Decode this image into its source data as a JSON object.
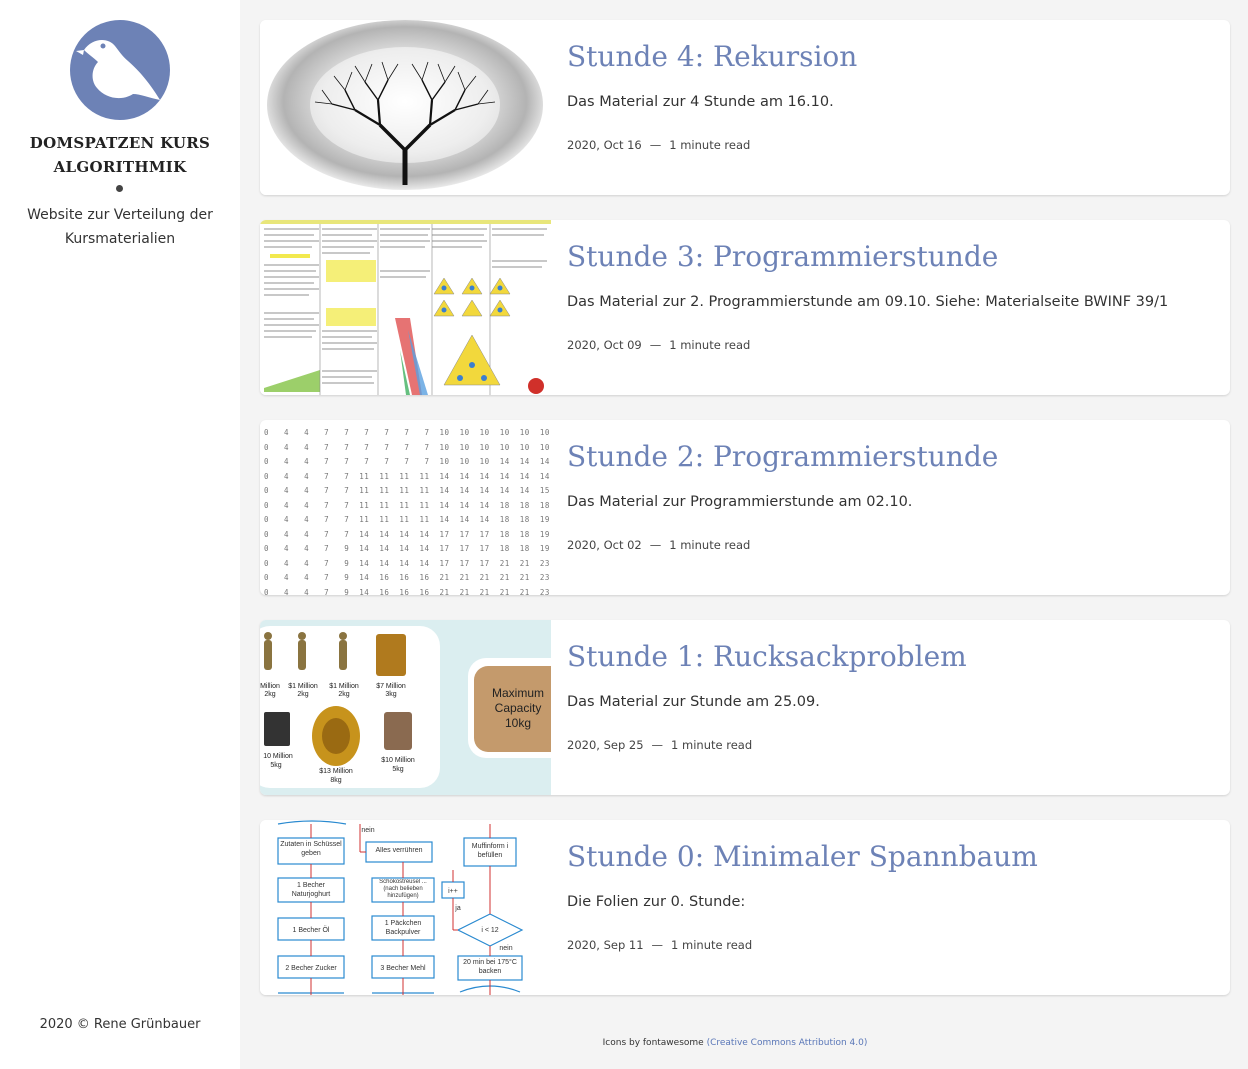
{
  "sidebar": {
    "logo_icon": "bird-icon",
    "title_line1": "DOMSPATZEN KURS",
    "title_line2": "ALGORITHMIK",
    "description": "Website zur Verteilung der Kursmaterialien",
    "copyright": "2020 © Rene Grünbauer"
  },
  "posts": [
    {
      "title": "Stunde 4: Rekursion",
      "excerpt": "Das Material zur 4 Stunde am 16.10.",
      "date": "2020, Oct 16",
      "read_time": "1 minute read",
      "thumbnail": "fractal-tree-image"
    },
    {
      "title": "Stunde 3: Programmierstunde",
      "excerpt": "Das Material zur 2. Programmierstunde am 09.10. Siehe: Materialseite BWINF 39/1",
      "date": "2020, Oct 09",
      "read_time": "1 minute read",
      "thumbnail": "worksheet-image"
    },
    {
      "title": "Stunde 2: Programmierstunde",
      "excerpt": "Das Material zur Programmierstunde am 02.10.",
      "date": "2020, Oct 02",
      "read_time": "1 minute read",
      "thumbnail": "number-table-image"
    },
    {
      "title": "Stunde 1: Rucksackproblem",
      "excerpt": "Das Material zur Stunde am 25.09.",
      "date": "2020, Sep 25",
      "read_time": "1 minute read",
      "thumbnail": "knapsack-image"
    },
    {
      "title": "Stunde 0: Minimaler Spannbaum",
      "excerpt": "Die Folien zur 0. Stunde:",
      "date": "2020, Sep 11",
      "read_time": "1 minute read",
      "thumbnail": "flowchart-image"
    }
  ],
  "meta_separator": "—",
  "thumb_text": {
    "knapsack": {
      "m1": "Million",
      "w1": "2kg",
      "m2": "$1 Million",
      "w2": "2kg",
      "m3": "$1 Million",
      "w3": "2kg",
      "m4": "$7 Million",
      "w4": "3kg",
      "m5": "10 Million",
      "w5": "5kg",
      "m6": "$13 Million",
      "w6": "8kg",
      "m7": "$10 Million",
      "w7": "5kg",
      "capacity": "Maximum Capacity 10kg"
    },
    "flowchart": {
      "n1": "Zutaten in Schüssel geben",
      "n2": "Alles verrühren",
      "n3": "Muffinform i befüllen",
      "n4": "1 Becher Naturjoghurt",
      "n5": "Schokostreusel ... (nach belieben hinzufügen)",
      "n6": "i++",
      "n7": "1 Becher Öl",
      "n8": "1 Päckchen Backpulver",
      "n9": "i < 12",
      "n10": "2 Becher Zucker",
      "n11": "3 Becher Mehl",
      "n12": "20 min bei 175°C backen",
      "l_nein1": "nein",
      "l_ja": "ja",
      "l_nein2": "nein"
    }
  },
  "footer": {
    "text": "Icons by fontawesome ",
    "link": "(Creative Commons Attribution 4.0)"
  }
}
